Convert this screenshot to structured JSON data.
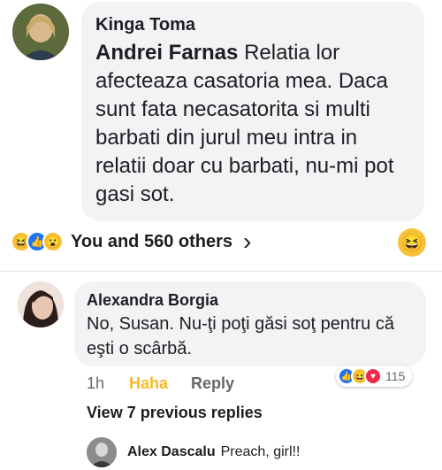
{
  "comment1": {
    "author": "Kinga Toma",
    "mention": "Andrei Farnas",
    "text": "Relatia  lor afecteaza casatoria mea. Daca sunt fata necasatorita si multi barbati din jurul meu intra in relatii doar cu barbati, nu-mi pot gasi sot."
  },
  "reactions_bar": {
    "summary": "You and 560 others",
    "icons": [
      "haha-icon",
      "like-icon",
      "wow-icon"
    ],
    "chevron": "›"
  },
  "comment2": {
    "author": "Alexandra Borgia",
    "text": "No, Susan. Nu-ţi poţi găsi soţ pentru că eşti o scârbă.",
    "time": "1h",
    "haha_label": "Haha",
    "reply_label": "Reply",
    "reaction_count": "115"
  },
  "view_previous": "View 7 previous replies",
  "reply1": {
    "author": "Alex Dascalu",
    "text": "Preach, girl!!"
  },
  "colors": {
    "haha_active": "#f7b928",
    "link_gray": "#65676b",
    "bubble": "#f2f3f5"
  }
}
